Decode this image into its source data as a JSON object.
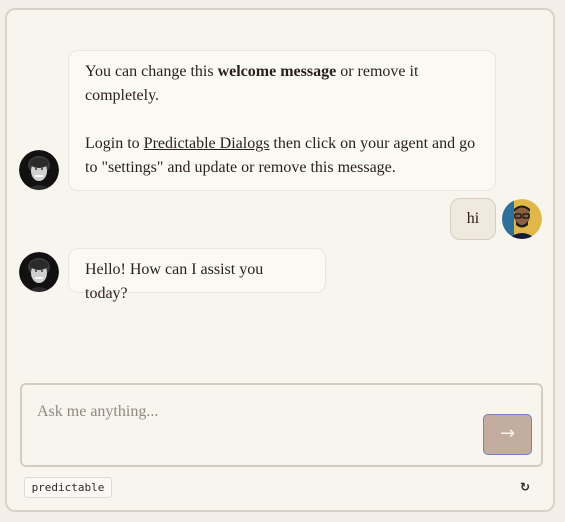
{
  "messages": [
    {
      "role": "bot",
      "avatar_icon": "bot-avatar-icon",
      "p1_prefix": "You can change this ",
      "p1_bold": "welcome message",
      "p1_suffix": " or remove it completely.",
      "p2_prefix": "Login to ",
      "p2_link": "Predictable Dialogs",
      "p2_suffix": " then click on your agent and go to \"settings\" and update or remove this message."
    },
    {
      "role": "user",
      "avatar_icon": "user-avatar-icon",
      "text": "hi"
    },
    {
      "role": "bot",
      "avatar_icon": "bot-avatar-icon",
      "text": "Hello! How can I assist you today?"
    }
  ],
  "composer": {
    "placeholder": "Ask me anything...",
    "send_icon": "arrow-right-icon",
    "send_glyph": "→"
  },
  "footer": {
    "brand_label": "predictable",
    "refresh_icon": "refresh-icon",
    "refresh_glyph": "↻"
  },
  "colors": {
    "background": "#f8f5ef",
    "border": "#d8d2ca",
    "send_button": "#c3ada1",
    "send_button_border": "#6e83c6",
    "text": "#2a1f1a"
  }
}
